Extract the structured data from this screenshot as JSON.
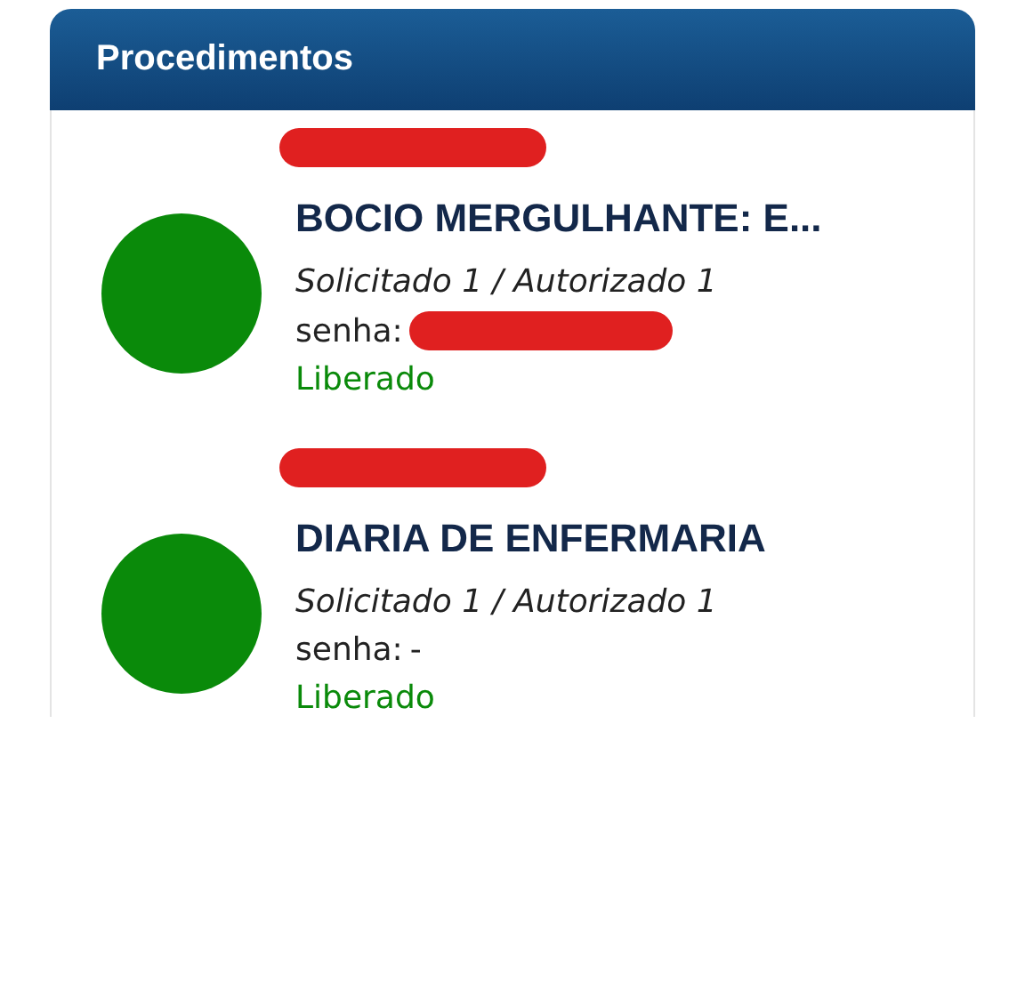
{
  "panel": {
    "title": "Procedimentos"
  },
  "procedures": [
    {
      "code_redacted": true,
      "color": "#0a8a0a",
      "title": "BOCIO MERGULHANTE: E...",
      "quantities": "Solicitado 1 / Autorizado 1",
      "password_label": "senha:",
      "password_redacted": true,
      "status": "Liberado"
    },
    {
      "code_redacted": true,
      "color": "#0a8a0a",
      "title": "DIARIA DE ENFERMARIA",
      "quantities": "Solicitado 1 / Autorizado 1",
      "password_label": "senha:",
      "password_value": "-",
      "password_redacted": false,
      "status": "Liberado"
    }
  ]
}
